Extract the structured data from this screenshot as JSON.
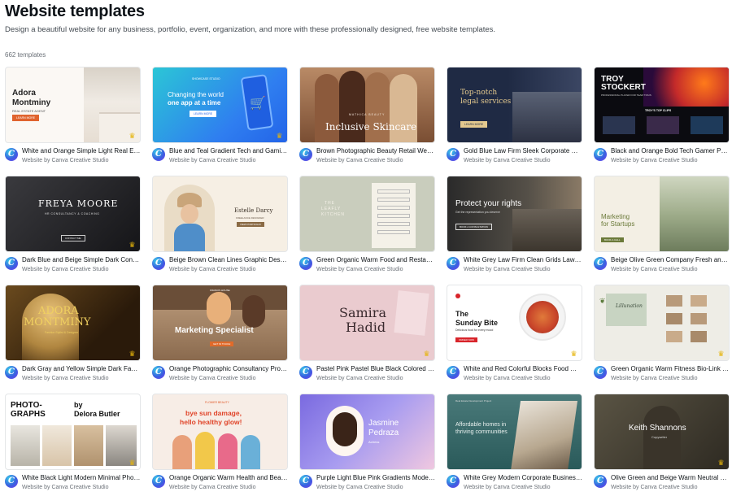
{
  "header": {
    "title": "Website templates",
    "subtitle": "Design a beautiful website for any business, portfolio, event, organization, and more with these professionally designed, free website templates.",
    "count": "662 templates"
  },
  "colors": {
    "crown": "#e5b40a",
    "brand_gradient_start": "#39d0e8",
    "brand_gradient_end": "#7b3ff0"
  },
  "templates": [
    {
      "title": "White and Orange Simple Light Real Estate Website",
      "by": "Website by Canva Creative Studio",
      "thumb": {
        "l1": "Adora",
        "l2": "Montminy",
        "l3": "REAL ESTATE AGENT",
        "btn": "LEARN MORE"
      }
    },
    {
      "title": "Blue and Teal Gradient Tech and Gaming Website",
      "by": "Website by Canva Creative Studio",
      "thumb": {
        "l1": "Changing the world",
        "l2": "one app at a time",
        "btn": "LEARN MORE",
        "logo": "SHOWCASE STUDIO"
      }
    },
    {
      "title": "Brown Photographic Beauty Retail Website",
      "by": "Website by Canva Creative Studio",
      "thumb": {
        "l1": "MATHICA BEAUTY",
        "l2": "Inclusive Skincare"
      }
    },
    {
      "title": "Gold Blue Law Firm Sleek Corporate Website",
      "by": "Website by Canva Creative Studio",
      "thumb": {
        "l1": "Top-notch",
        "l2": "legal services",
        "btn": "LEARN MORE"
      }
    },
    {
      "title": "Black and Orange Bold Tech Gamer Portfolio Website",
      "by": "Website by Canva Creative Studio",
      "thumb": {
        "l1": "TROY",
        "l2": "STOCKERT",
        "l3": "PROFESSIONAL PLAYER FOR TEAM TRIUS",
        "l4": "TROY'S TOP CLIPS"
      }
    },
    {
      "title": "Dark Blue and Beige Simple Dark Consulting Website",
      "by": "Website by Canva Creative Studio",
      "thumb": {
        "l1": "FREYA MOORE",
        "l2": "HR CONSULTANCY & COACHING",
        "btn": "CONTACT ME"
      }
    },
    {
      "title": "Beige Brown Clean Lines Graphic Designer Website",
      "by": "Website by Canva Creative Studio",
      "thumb": {
        "l1": "Estelle Darcy",
        "l2": "FREELANCE DESIGNER",
        "btn": "VIEW PORTFOLIO"
      }
    },
    {
      "title": "Green Organic Warm Food and Restaurant Website",
      "by": "Website by Canva Creative Studio",
      "thumb": {
        "l1": "THE",
        "l2": "LEAFLY",
        "l3": "KITCHEN"
      }
    },
    {
      "title": "White Grey Law Firm Clean Grids Law Website",
      "by": "Website by Canva Creative Studio",
      "thumb": {
        "l1": "Protect your rights",
        "l2": "Get the representation you deserve",
        "btn": "BOOK A CONSULTATION"
      }
    },
    {
      "title": "Beige Olive Green Company Fresh and Modern Website",
      "by": "Website by Canva Creative Studio",
      "thumb": {
        "l1": "Marketing",
        "l2": "for Startups",
        "btn": "BOOK A CALL"
      }
    },
    {
      "title": "Dark Gray and Yellow Simple Dark Fashion Website",
      "by": "Website by Canva Creative Studio",
      "thumb": {
        "l1": "ADORA",
        "l2": "MONTMINY",
        "l3": "Fashion Stylist & Designer"
      }
    },
    {
      "title": "Orange Photographic Consultancy Professional Website",
      "by": "Website by Canva Creative Studio",
      "thumb": {
        "l1": "Marketing Specialist",
        "l2": "FRANCIS HOUSE",
        "btn": "GET IN TOUCH"
      }
    },
    {
      "title": "Pastel Pink Pastel Blue Black Colored Website",
      "by": "Website by Canva Creative Studio",
      "thumb": {
        "l1": "Samira",
        "l2": "Hadid"
      }
    },
    {
      "title": "White and Red Colorful Blocks Food Website",
      "by": "Website by Canva Creative Studio",
      "thumb": {
        "l1": "The",
        "l2": "Sunday Bite",
        "l3": "Delicious food for every mood",
        "btn": "ORDER NOW"
      }
    },
    {
      "title": "Green Organic Warm Fitness Bio-Link Website",
      "by": "Website by Canva Creative Studio",
      "thumb": {
        "l1": "Lillunation"
      }
    },
    {
      "title": "White Black Light Modern Minimal Photography Website",
      "by": "Website by Canva Creative Studio",
      "thumb": {
        "l1": "PHOTO-",
        "l2": "GRAPHS",
        "l3": "by",
        "l4": "Delora Butler"
      }
    },
    {
      "title": "Orange Organic Warm Health and Beauty Website",
      "by": "Website by Canva Creative Studio",
      "thumb": {
        "l1": "FLOWER BEAUTY",
        "l2": "bye sun damage,",
        "l3": "hello healthy glow!"
      }
    },
    {
      "title": "Purple Light Blue Pink Gradients Modern Website",
      "by": "Website by Canva Creative Studio",
      "thumb": {
        "l1": "Jasmine",
        "l2": "Pedraza",
        "l3": "Actress"
      }
    },
    {
      "title": "White Grey Modern Corporate Business Website",
      "by": "Website by Canva Creative Studio",
      "thumb": {
        "l1": "Affordable homes in",
        "l2": "thriving communities",
        "l3": "Real Estate Development Project"
      }
    },
    {
      "title": "Olive Green and Beige Warm Neutral Website",
      "by": "Website by Canva Creative Studio",
      "thumb": {
        "l1": "Keith Shannons",
        "l2": "Copywriter"
      }
    }
  ]
}
